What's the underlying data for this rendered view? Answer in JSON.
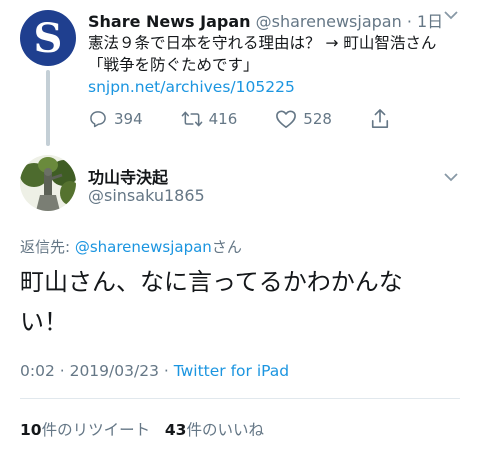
{
  "original_tweet": {
    "author_name": "Share News Japan",
    "author_handle": "@sharenewsjapan",
    "time_sep": " · ",
    "time": "1日",
    "avatar_letter": "S",
    "text": "憲法９条で日本を守れる理由は？ → 町山智浩さん「戦争を防ぐためです」 ",
    "link": "snjpn.net/archives/105225",
    "reply_count": "394",
    "retweet_count": "416",
    "like_count": "528"
  },
  "reply_tweet": {
    "author_name": "功山寺決起",
    "author_handle": "@sinsaku1865",
    "reply_prefix": "返信先: ",
    "reply_to": "@sharenewsjapan",
    "reply_suffix": "さん",
    "text": "町山さん、なに言ってるかわかんない！",
    "timestamp": "0:02 · 2019/03/23 · ",
    "source": "Twitter for iPad",
    "retweets_value": "10",
    "retweets_label": "件のリツイート",
    "likes_value": "43",
    "likes_label": "件のいいね"
  },
  "icons": {
    "reply": "reply-icon",
    "retweet": "retweet-icon",
    "like": "heart-icon",
    "share": "share-icon",
    "menu": "chevron-down-icon"
  },
  "colors": {
    "link": "#1b95e0",
    "muted": "#657786",
    "brand_avatar": "#1f3f8f"
  }
}
